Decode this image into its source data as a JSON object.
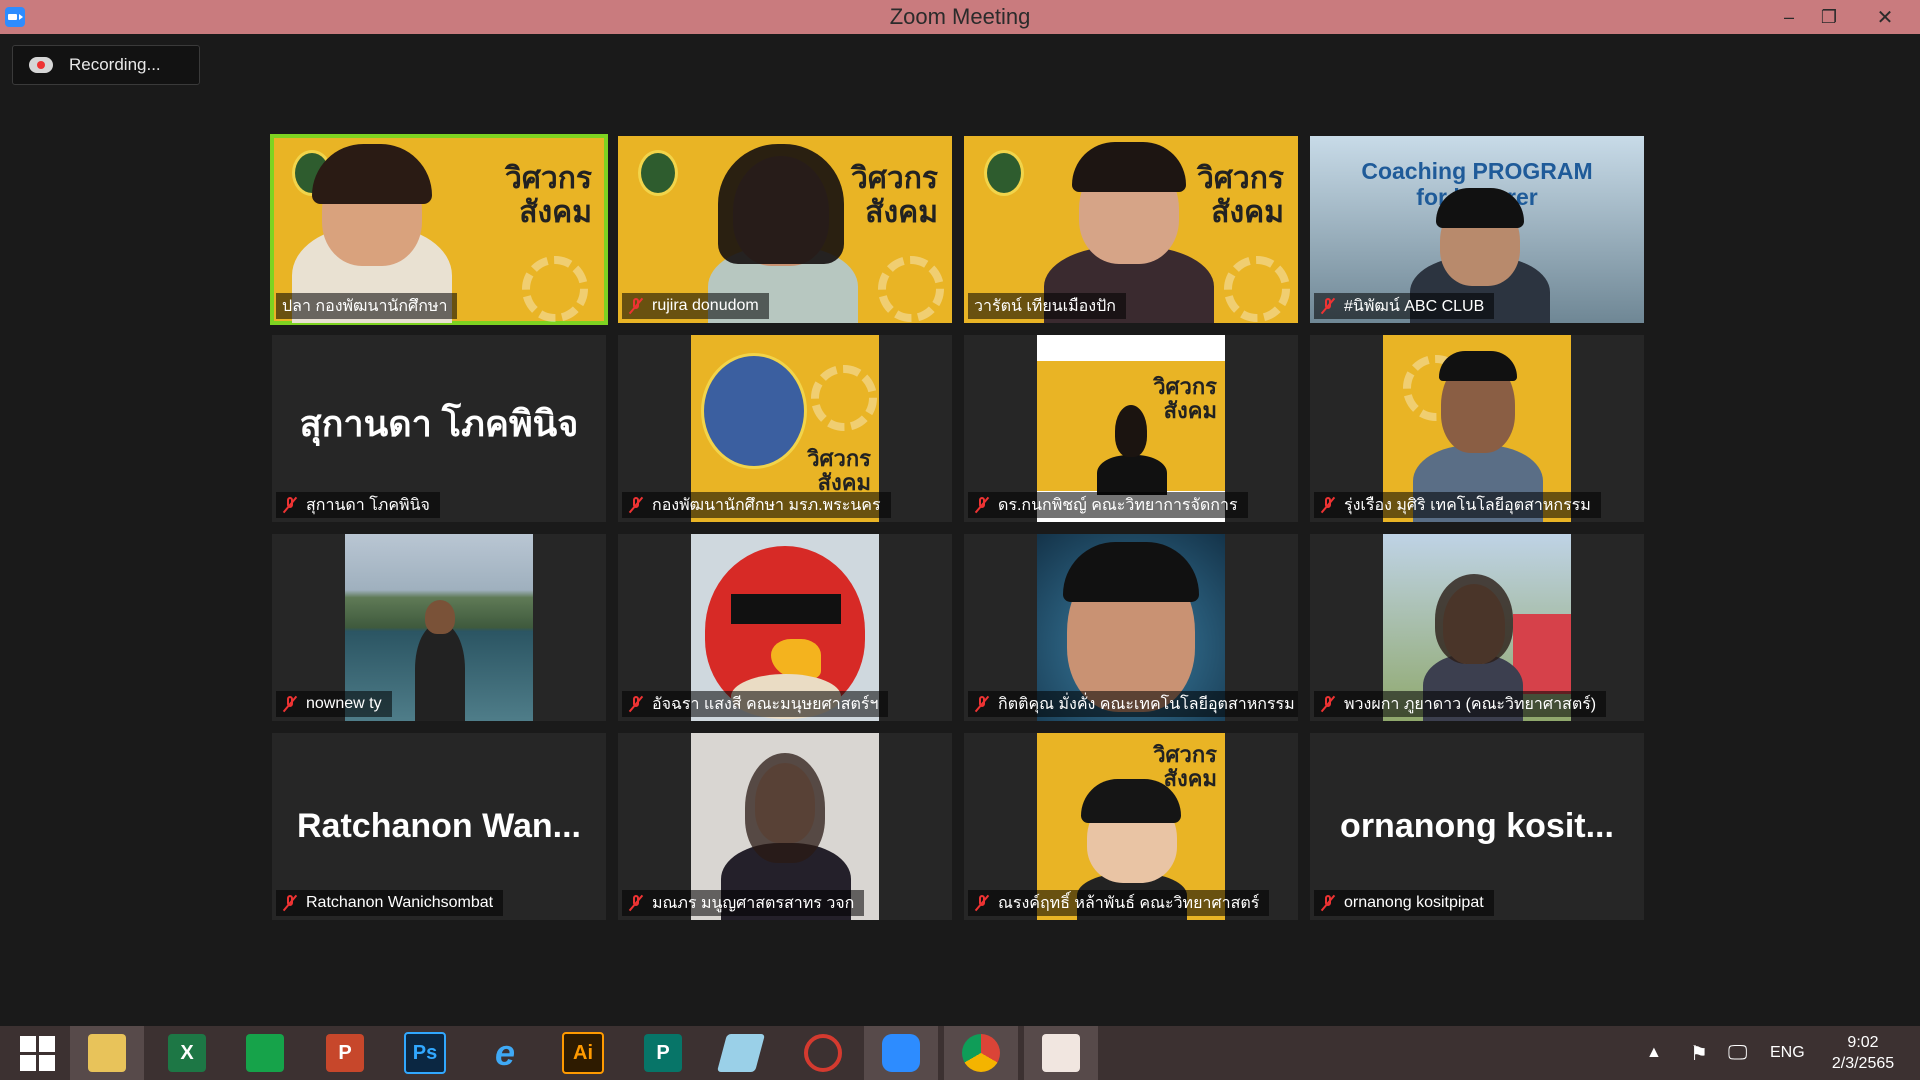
{
  "window": {
    "title": "Zoom Meeting",
    "controls": {
      "minimize": "–",
      "maximize": "❐",
      "close": "✕"
    }
  },
  "recording": {
    "label": "Recording..."
  },
  "participants": [
    {
      "name": "ปลา กองพัฒนานักศึกษา",
      "muted": false,
      "active_speaker": true,
      "video": "poster"
    },
    {
      "name": "rujira donudom",
      "muted": true,
      "video": "poster"
    },
    {
      "name": "วารัตน์ เทียนเมืองปัก",
      "muted": true,
      "video": "poster"
    },
    {
      "name": "#นิพัฒน์ ABC CLUB",
      "muted": true,
      "video": "coaching"
    },
    {
      "name": "สุกานดา โภคพินิจ",
      "display_text": "สุกานดา โภคพินิจ",
      "muted": true,
      "video": "off"
    },
    {
      "name": "กองพัฒนานักศึกษา มรภ.พระนคร",
      "muted": true,
      "video": "logo"
    },
    {
      "name": "ดร.กนกพิชญ์ คณะวิทยาการจัดการ",
      "muted": true,
      "video": "poster-small"
    },
    {
      "name": "รุ่งเรือง มุศิริ เทคโนโลยีอุตสาหกรรม",
      "muted": true,
      "video": "poster-small"
    },
    {
      "name": "nownew ty",
      "muted": true,
      "video": "photo"
    },
    {
      "name": "อัจฉรา แสงสี คณะมนุษยศาสตร์ฯ",
      "muted": true,
      "video": "photo"
    },
    {
      "name": "กิตติคุณ มั่งคั่ง คณะเทคโนโลยีอุตสาหกรรม",
      "muted": true,
      "video": "photo"
    },
    {
      "name": "พวงผกา ภูยาดาว (คณะวิทยาศาสตร์)",
      "muted": true,
      "video": "photo"
    },
    {
      "name": "Ratchanon Wanichsombat",
      "display_text": "Ratchanon  Wan...",
      "muted": true,
      "video": "off"
    },
    {
      "name": "มณภร มนูญศาสตรสาทร วจก",
      "muted": true,
      "video": "photo"
    },
    {
      "name": "ณรงค์ฤทธิ์ หล้าพันธ์ คณะวิทยาศาสตร์",
      "muted": true,
      "video": "poster-small"
    },
    {
      "name": "ornanong kositpipat",
      "display_text": "ornanong  kosit...",
      "muted": true,
      "video": "off"
    }
  ],
  "poster": {
    "line1": "วิศวกร",
    "line2": "สังคม",
    "coaching_line1": "Coaching PROGRAM",
    "coaching_line2": "for lecturer"
  },
  "taskbar": {
    "apps": [
      "start-icon",
      "file-explorer-icon",
      "excel-icon",
      "store-icon",
      "powerpoint-icon",
      "photoshop-icon",
      "internet-explorer-icon",
      "illustrator-icon",
      "publisher-icon",
      "notepad-icon",
      "photoscape-icon",
      "zoom-icon",
      "chrome-icon",
      "office-lens-icon"
    ],
    "app_labels": {
      "excel": "X",
      "powerpoint": "P",
      "photoshop": "Ps",
      "illustrator": "Ai",
      "publisher": "P"
    },
    "language": "ENG",
    "time": "9:02",
    "date": "2/3/2565"
  },
  "colors": {
    "titlebar": "#c97b7e",
    "active_border": "#7ed321",
    "muted_icon": "#e33333",
    "poster_yellow": "#e9b425"
  }
}
